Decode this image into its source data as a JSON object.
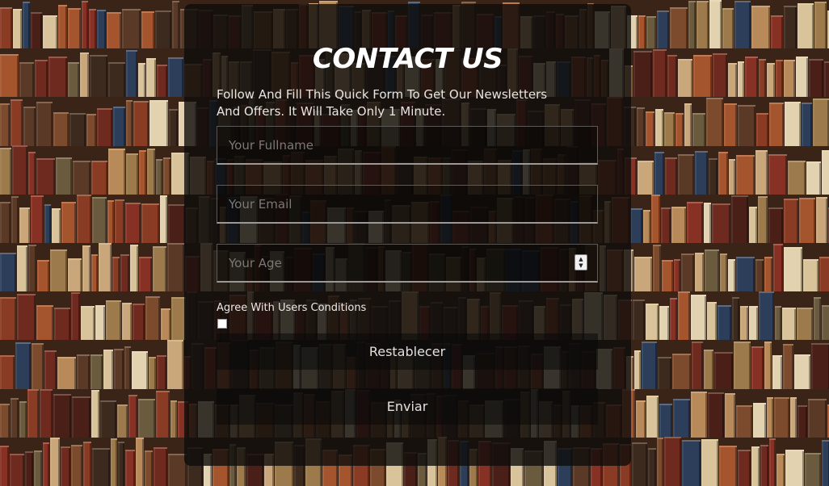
{
  "form": {
    "title": "CONTACT US",
    "subtitle": "Follow And Fill This Quick Form To Get Our Newsletters And Offers. It Will Take Only 1 Minute.",
    "fullname_placeholder": "Your Fullname",
    "email_placeholder": "Your Email",
    "age_placeholder": "Your Age",
    "agree_label": "Agree With Users Conditions",
    "reset_label": "Restablecer",
    "submit_label": "Enviar"
  },
  "colors": {
    "panel": "#0e0c0b",
    "text": "#ffffff",
    "placeholder": "#7b7875"
  }
}
